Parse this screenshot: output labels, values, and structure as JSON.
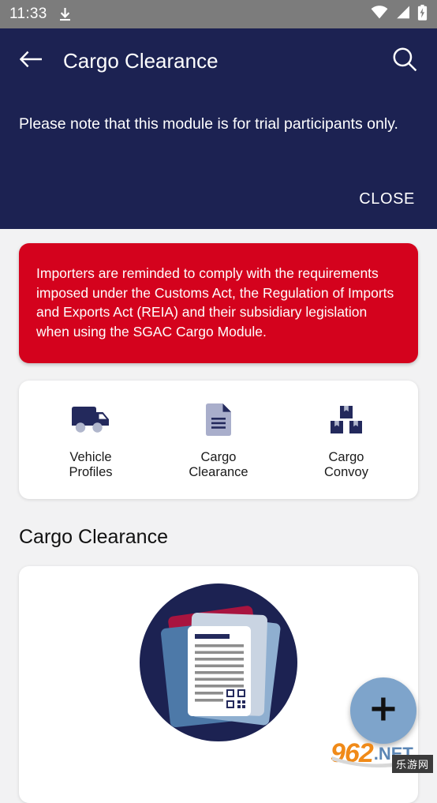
{
  "status_bar": {
    "time": "11:33",
    "icons": [
      "download-icon",
      "wifi-icon",
      "cellular-signal-icon",
      "battery-charging-icon"
    ]
  },
  "app_bar": {
    "back_icon": "arrow-left-icon",
    "title": "Cargo Clearance",
    "search_icon": "search-icon",
    "background_color": "#1c2252"
  },
  "notice": {
    "message": "Please note that this module is for trial participants only.",
    "close_label": "CLOSE",
    "background_color": "#1c2252"
  },
  "alert": {
    "message": "Importers are reminded to comply with the requirements imposed under the Customs Act, the Regulation of Imports and Exports Act (REIA) and their subsidiary legislation when using the SGAC Cargo Module.",
    "background_color": "#d4021d"
  },
  "shortcuts": [
    {
      "icon": "truck-icon",
      "label": "Vehicle\nProfiles"
    },
    {
      "icon": "document-icon",
      "label": "Cargo\nClearance"
    },
    {
      "icon": "boxes-icon",
      "label": "Cargo\nConvoy"
    }
  ],
  "section": {
    "title": "Cargo Clearance"
  },
  "illustration": {
    "name": "documents-clipboard-qr-illustration",
    "circle_color": "#1c2252",
    "accent_color": "#b4, #a8143f"
  },
  "fab": {
    "icon": "plus-icon",
    "color": "#7ea4cb"
  },
  "watermark": {
    "number": "962",
    "domain": ".NET",
    "cn_text": "乐游网"
  }
}
